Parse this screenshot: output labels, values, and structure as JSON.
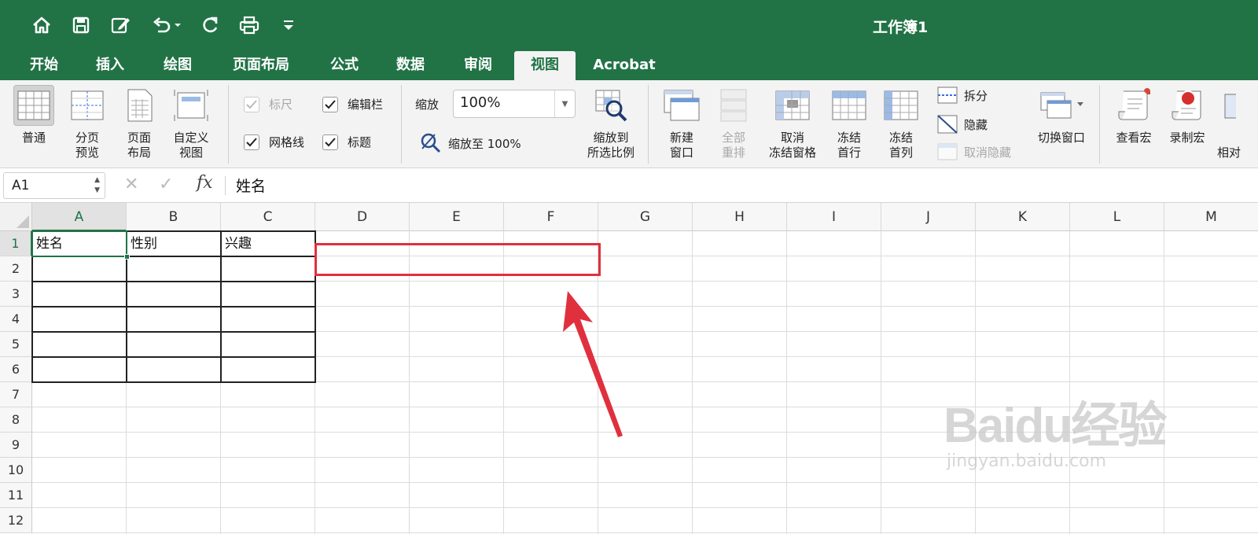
{
  "app": {
    "document_title": "工作簿1",
    "accent_color": "#217346",
    "quick_access": [
      "home-icon",
      "save-icon",
      "edit-icon",
      "undo-icon",
      "redo-icon",
      "print-icon",
      "customize-icon"
    ]
  },
  "tabs": [
    {
      "label": "开始"
    },
    {
      "label": "插入"
    },
    {
      "label": "绘图"
    },
    {
      "label": "页面布局"
    },
    {
      "label": "公式"
    },
    {
      "label": "数据"
    },
    {
      "label": "审阅"
    },
    {
      "label": "视图",
      "active": true
    },
    {
      "label": "Acrobat"
    }
  ],
  "ribbon": {
    "views": [
      {
        "line1": "普通",
        "line2": "",
        "selected": true
      },
      {
        "line1": "分页",
        "line2": "预览"
      },
      {
        "line1": "页面",
        "line2": "布局"
      },
      {
        "line1": "自定义",
        "line2": "视图"
      }
    ],
    "show": {
      "ruler": {
        "label": "标尺",
        "checked": true,
        "disabled": true
      },
      "formula_bar": {
        "label": "编辑栏",
        "checked": true
      },
      "gridlines": {
        "label": "网格线",
        "checked": true
      },
      "headings": {
        "label": "标题",
        "checked": true
      }
    },
    "zoom": {
      "label": "缩放",
      "value": "100%",
      "zoom100_label": "缩放至 100%",
      "zoom_selection": {
        "line1": "缩放到",
        "line2": "所选比例"
      }
    },
    "window": {
      "new_window": {
        "line1": "新建",
        "line2": "窗口"
      },
      "arrange_all": {
        "line1": "全部",
        "line2": "重排",
        "disabled": true
      },
      "unfreeze": {
        "line1": "取消",
        "line2": "冻结窗格"
      },
      "freeze_top_row": {
        "line1": "冻结",
        "line2": "首行"
      },
      "freeze_first_col": {
        "line1": "冻结",
        "line2": "首列"
      },
      "split": "拆分",
      "hide": "隐藏",
      "unhide": "取消隐藏",
      "switch_windows": "切换窗口"
    },
    "macros": {
      "view_macros": "查看宏",
      "record_macro": "录制宏",
      "relative_partial": "相对"
    }
  },
  "formula_bar": {
    "name_box": "A1",
    "fx_label": "fx",
    "content": "姓名"
  },
  "sheet": {
    "columns": [
      "A",
      "B",
      "C",
      "D",
      "E",
      "F",
      "G",
      "H",
      "I",
      "J",
      "K",
      "L",
      "M"
    ],
    "rows": [
      "1",
      "2",
      "3",
      "4",
      "5",
      "6",
      "7",
      "8",
      "9",
      "10",
      "11",
      "12"
    ],
    "active_cell": "A1",
    "cells": {
      "A1": "姓名",
      "B1": "性别",
      "C1": "兴趣"
    },
    "annotation_color": "#e0303e"
  },
  "watermark": {
    "main": "Baidu经验",
    "url": "jingyan.baidu.com"
  }
}
